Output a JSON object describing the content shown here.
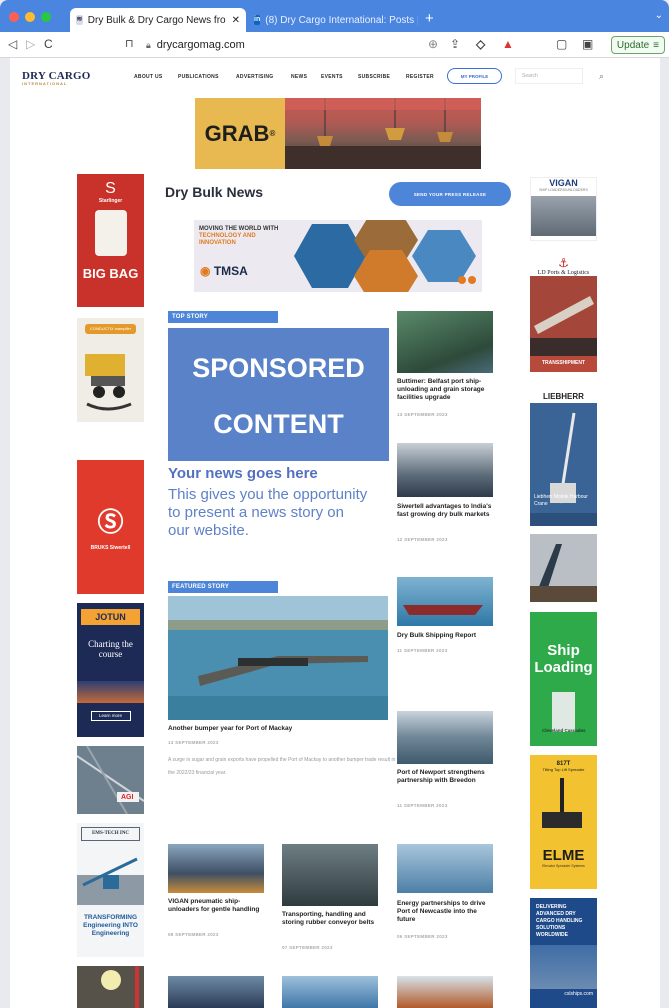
{
  "browser": {
    "tabs": [
      {
        "label": "Dry Bulk & Dry Cargo News fro",
        "active": true,
        "favicon": "Cargo"
      },
      {
        "label": "(8) Dry Cargo International: Posts |",
        "active": false,
        "favicon": "in"
      }
    ],
    "url": "drycargomag.com",
    "update_label": "Update",
    "traffic_lights": [
      "#ff5f57",
      "#febc2e",
      "#28c840"
    ]
  },
  "nav": {
    "logo": "DRY CARGO",
    "logo_sub": "INTERNATIONAL",
    "items": [
      "ABOUT US",
      "PUBLICATIONS",
      "ADVERTISING",
      "NEWS",
      "EVENTS",
      "SUBSCRIBE",
      "REGISTER"
    ],
    "profile_label": "MY PROFILE",
    "search_placeholder": "Search"
  },
  "top_banner": {
    "brand": "GRAB",
    "mark": "®"
  },
  "section": {
    "title": "Dry Bulk News",
    "press_button": "SEND YOUR PRESS RELEASE"
  },
  "tmsa_banner": {
    "line1": "MOVING THE WORLD WITH",
    "line2": "TECHNOLOGY AND",
    "line3": "INNOVATION",
    "brand": "TMSA"
  },
  "top_story": {
    "badge": "TOP STORY",
    "box_line1": "SPONSORED",
    "box_line2": "CONTENT",
    "headline": "Your news goes here",
    "body": "This gives you the opportunity to present a news story on our website."
  },
  "featured": {
    "badge": "FEATURED STORY",
    "title": "Another bumper year for Port of Mackay",
    "date": "13 SEPTEMBER 2023",
    "desc": "A surge in sugar and grain exports have propelled the Port of Mackay to another bumper trade result in the 2022/23 financial year."
  },
  "side_stories": [
    {
      "title": "Buttimer: Belfast port ship-unloading and grain storage facilities upgrade",
      "date": "13 SEPTEMBER 2023"
    },
    {
      "title": "Siwertell advantages to India's fast growing dry bulk markets",
      "date": "12 SEPTEMBER 2023"
    },
    {
      "title": "Dry Bulk Shipping Report",
      "date": "11 SEPTEMBER 2023"
    },
    {
      "title": "Port of Newport strengthens partnership with Breedon",
      "date": "11 SEPTEMBER 2023"
    }
  ],
  "bottom_stories": [
    {
      "title": "VIGAN pneumatic ship-unloaders for gentle handling",
      "date": "08 SEPTEMBER 2023"
    },
    {
      "title": "Transporting, handling and storing rubber conveyor belts",
      "date": "07 SEPTEMBER 2023"
    },
    {
      "title": "Energy partnerships to drive Port of Newcastle into the future",
      "date": "06 SEPTEMBER 2023"
    }
  ],
  "left_ads": {
    "starlinger_brand": "Starlinger",
    "starlinger_tag": "BIG BAG",
    "conductix_brand": "CONDUCTIX wampfler",
    "bruks_brand": "BRUKS Siwertell",
    "jotun_brand": "JOTUN",
    "jotun_tag": "Charting the course",
    "jotun_cta": "Learn more",
    "agi_brand": "AGI",
    "emstech_brand": "EMS-TECH INC",
    "emstech_tag": "TRANSFORMING Engineering INTO Engineering"
  },
  "right_ads": {
    "vigan_brand": "VIGAN",
    "vigan_tag": "SHIP LOADERS/UNLOADERS",
    "ldports_brand": "LD Ports & Logistics",
    "ldports_tag": "TRANSSHIPMENT",
    "liebherr_brand": "LIEBHERR",
    "liebherr_tag": "Liebherr Mobile Harbour Crane",
    "cleveland_line1": "Ship",
    "cleveland_line2": "Loading",
    "cleveland_brand": "Cleveland Cascades",
    "elme_model": "817T",
    "elme_tag": "Tilting Top Lift Spreader",
    "elme_brand": "ELME",
    "elme_sub": "Elevator Spreader Systems",
    "csl_text": "DELIVERING ADVANCED DRY CARGO HANDLING SOLUTIONS WORLDWIDE",
    "csl_brand": "cslships.com"
  }
}
